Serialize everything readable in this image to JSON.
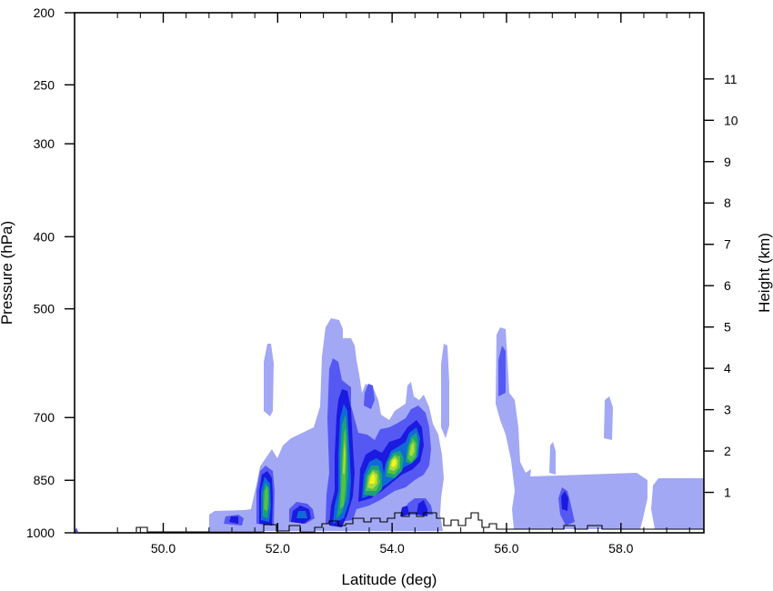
{
  "chart_data": {
    "type": "heatmap",
    "xlabel": "Latitude (deg)",
    "ylabel_left": "Pressure (hPa)",
    "ylabel_right": "Height (km)",
    "xlim": [
      48.45,
      59.45
    ],
    "ylim_left": [
      1000,
      200
    ],
    "y_scale_left": "log",
    "x_ticks": [
      "50.0",
      "52.0",
      "54.0",
      "56.0",
      "58.0"
    ],
    "y_ticks_left": [
      "200",
      "250",
      "300",
      "400",
      "500",
      "700",
      "850",
      "1000"
    ],
    "y_ticks_right": [
      "1",
      "2",
      "3",
      "4",
      "5",
      "6",
      "7",
      "8",
      "9",
      "10",
      "11"
    ],
    "contour_colors": [
      "#a2a8f4",
      "#5658f4",
      "#1a1ae0",
      "#0f6ad8",
      "#1aa07c",
      "#55c048",
      "#a8dc3c",
      "#f4f414"
    ],
    "cells": [
      {
        "lat": 48.45,
        "p": 1000,
        "level": 1
      },
      {
        "lat": 51.2,
        "p": 980,
        "level": 2
      },
      {
        "lat": 51.4,
        "p": 980,
        "level": 1
      },
      {
        "lat": 51.8,
        "p": 870,
        "level": 6
      },
      {
        "lat": 51.8,
        "p": 930,
        "level": 4
      },
      {
        "lat": 51.8,
        "p": 800,
        "level": 1
      },
      {
        "lat": 51.8,
        "p": 650,
        "level": 1
      },
      {
        "lat": 52.45,
        "p": 965,
        "level": 4
      },
      {
        "lat": 52.45,
        "p": 965,
        "level": 1
      },
      {
        "lat": 53.1,
        "p": 790,
        "level": 7
      },
      {
        "lat": 53.1,
        "p": 700,
        "level": 4
      },
      {
        "lat": 53.1,
        "p": 900,
        "level": 3
      },
      {
        "lat": 53.6,
        "p": 860,
        "level": 8
      },
      {
        "lat": 53.6,
        "p": 870,
        "level": 4
      },
      {
        "lat": 54.0,
        "p": 820,
        "level": 8
      },
      {
        "lat": 54.0,
        "p": 830,
        "level": 4
      },
      {
        "lat": 54.4,
        "p": 790,
        "level": 6
      },
      {
        "lat": 54.4,
        "p": 800,
        "level": 3
      },
      {
        "lat": 54.8,
        "p": 950,
        "level": 1
      },
      {
        "lat": 55.9,
        "p": 630,
        "level": 2
      },
      {
        "lat": 55.9,
        "p": 650,
        "level": 1
      },
      {
        "lat": 57.0,
        "p": 940,
        "level": 2
      },
      {
        "lat": 57.6,
        "p": 900,
        "level": 1
      },
      {
        "lat": 59.0,
        "p": 900,
        "level": 1
      }
    ]
  }
}
